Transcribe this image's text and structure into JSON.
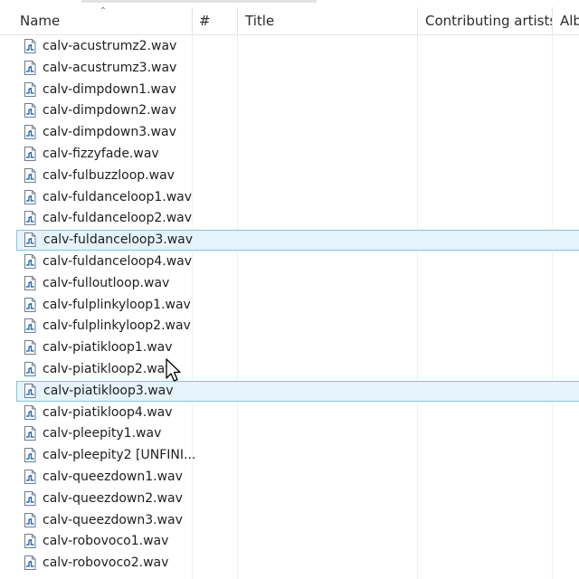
{
  "columns": {
    "name": "Name",
    "number": "#",
    "title": "Title",
    "contributing_artists": "Contributing artists",
    "album": "Alb"
  },
  "files": [
    {
      "name": "calv-acustrumz2.wav",
      "selected": false
    },
    {
      "name": "calv-acustrumz3.wav",
      "selected": false
    },
    {
      "name": "calv-dimpdown1.wav",
      "selected": false
    },
    {
      "name": "calv-dimpdown2.wav",
      "selected": false
    },
    {
      "name": "calv-dimpdown3.wav",
      "selected": false
    },
    {
      "name": "calv-fizzyfade.wav",
      "selected": false
    },
    {
      "name": "calv-fulbuzzloop.wav",
      "selected": false
    },
    {
      "name": "calv-fuldanceloop1.wav",
      "selected": false
    },
    {
      "name": "calv-fuldanceloop2.wav",
      "selected": false
    },
    {
      "name": "calv-fuldanceloop3.wav",
      "selected": true
    },
    {
      "name": "calv-fuldanceloop4.wav",
      "selected": false
    },
    {
      "name": "calv-fulloutloop.wav",
      "selected": false
    },
    {
      "name": "calv-fulplinkyloop1.wav",
      "selected": false
    },
    {
      "name": "calv-fulplinkyloop2.wav",
      "selected": false
    },
    {
      "name": "calv-piatikloop1.wav",
      "selected": false
    },
    {
      "name": "calv-piatikloop2.wav",
      "selected": false
    },
    {
      "name": "calv-piatikloop3.wav",
      "selected": true
    },
    {
      "name": "calv-piatikloop4.wav",
      "selected": false
    },
    {
      "name": "calv-pleepity1.wav",
      "selected": false
    },
    {
      "name": "calv-pleepity2 [UNFINI...",
      "selected": false
    },
    {
      "name": "calv-queezdown1.wav",
      "selected": false
    },
    {
      "name": "calv-queezdown2.wav",
      "selected": false
    },
    {
      "name": "calv-queezdown3.wav",
      "selected": false
    },
    {
      "name": "calv-robovoco1.wav",
      "selected": false
    },
    {
      "name": "calv-robovoco2.wav",
      "selected": false
    }
  ],
  "icons": {
    "file": "audio-file-icon",
    "sort": "sort-ascending-icon",
    "cursor": "mouse-pointer-icon"
  },
  "colors": {
    "selection_fill": "#e5f3fb",
    "selection_border": "#7ec8e3",
    "icon_accent": "#2b6cb0"
  }
}
